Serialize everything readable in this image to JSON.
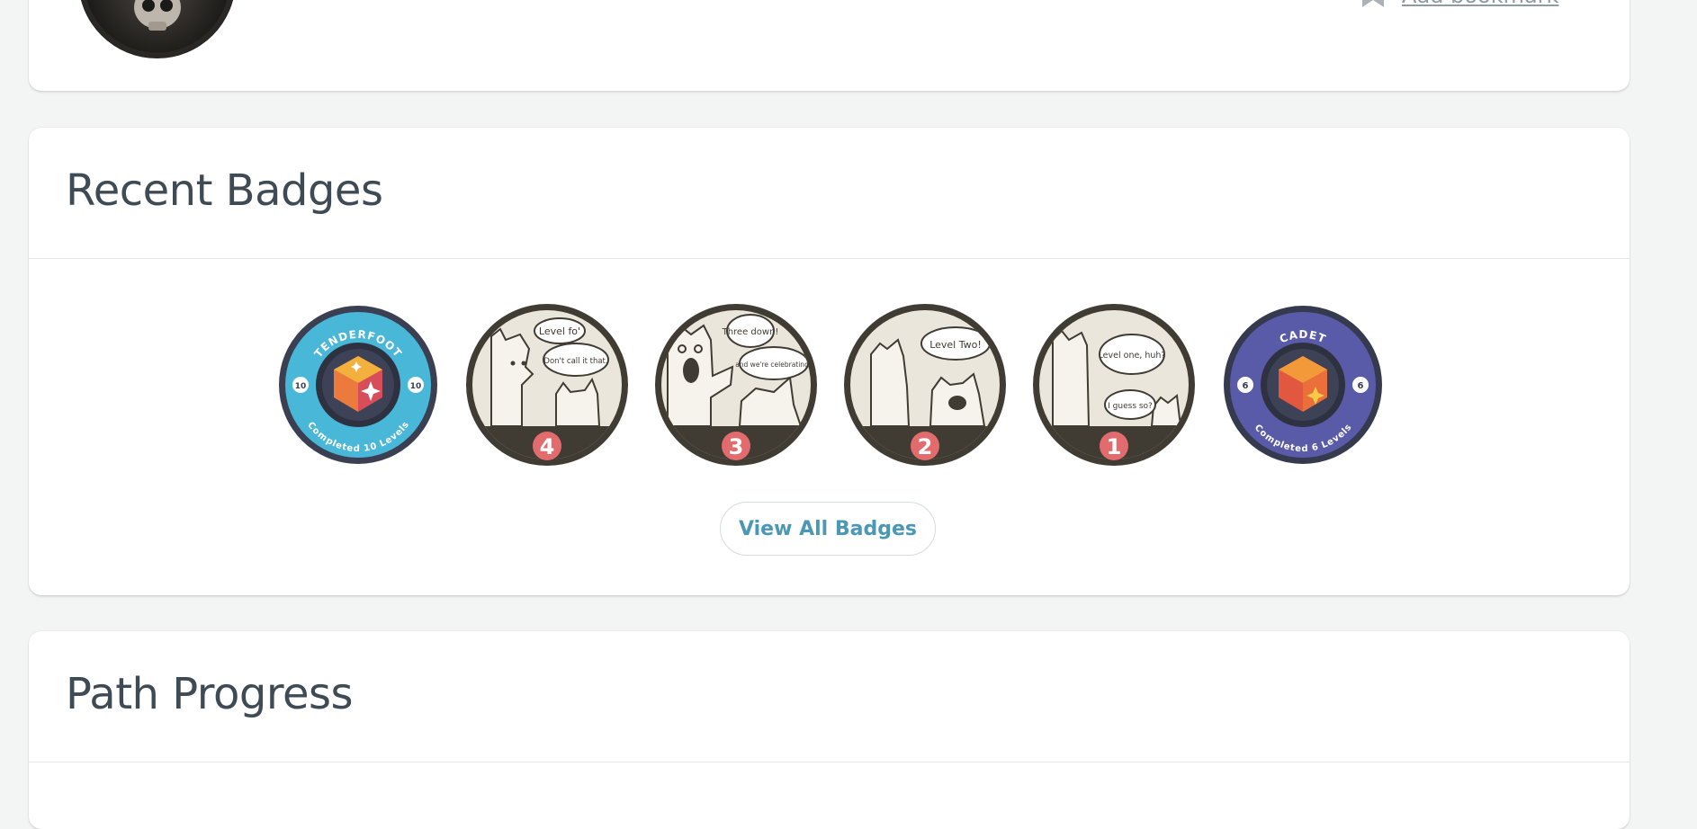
{
  "top_card": {
    "bookmark_label": "Add bookmark",
    "avatar_icon": "skull-icon",
    "bookmark_icon": "bookmark-plus-icon"
  },
  "badges_section": {
    "title": "Recent Badges",
    "view_all_label": "View All Badges",
    "badges": [
      {
        "name": "Tenderfoot",
        "top_text": "TENDERFOOT",
        "bottom_text": "Completed 10 Levels",
        "side_number": "10",
        "ring_color": "#49b7d8"
      },
      {
        "name": "Level 4 comic",
        "speech_1": "Level fo'",
        "speech_2": "Don't call it that.",
        "number": "4"
      },
      {
        "name": "Level 3 comic",
        "speech_1": "Three down!",
        "speech_2": "and we're celebrating?",
        "number": "3"
      },
      {
        "name": "Level 2 comic",
        "speech_1": "Level Two!",
        "number": "2"
      },
      {
        "name": "Level 1 comic",
        "speech_1": "Level one, huh?",
        "speech_2": "I guess so?",
        "number": "1"
      },
      {
        "name": "Cadet",
        "top_text": "CADET",
        "bottom_text": "Completed 6 Levels",
        "side_number": "6",
        "ring_color": "#5a5ba8"
      }
    ]
  },
  "path_section": {
    "title": "Path Progress"
  },
  "colors": {
    "badge_number_bg": "#e26b6d",
    "comic_dark": "#403c33",
    "comic_light": "#eae6dc",
    "link_blue": "#4c97b5"
  }
}
